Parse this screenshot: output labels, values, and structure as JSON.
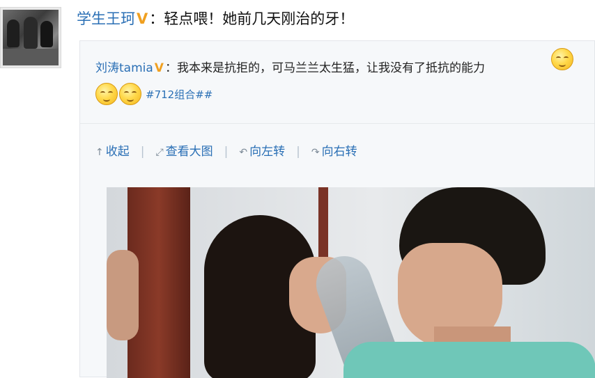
{
  "post": {
    "author": "学生王珂",
    "verified_mark": "V",
    "text": "：轻点喂！她前几天刚治的牙！"
  },
  "repost": {
    "author": "刘涛tamia",
    "verified_mark": "V",
    "text": "：我本来是抗拒的，可马兰兰太生猛，让我没有了抵抗的能力",
    "topic": "#712组合##"
  },
  "actions": {
    "collapse": {
      "icon": "↑",
      "label": "收起"
    },
    "view_large": {
      "icon": "⤢",
      "label": "查看大图"
    },
    "rotate_left": {
      "icon": "↶",
      "label": "向左转"
    },
    "rotate_right": {
      "icon": "↷",
      "label": "向右转"
    },
    "separator": "|"
  },
  "colors": {
    "link": "#2a6fb5",
    "verified": "#f0a020",
    "repost_bg": "#f6f8fa"
  },
  "icons": [
    "avatar-photo",
    "dizzy-face-emoji",
    "arrow-up-icon",
    "expand-icon",
    "rotate-left-icon",
    "rotate-right-icon"
  ]
}
